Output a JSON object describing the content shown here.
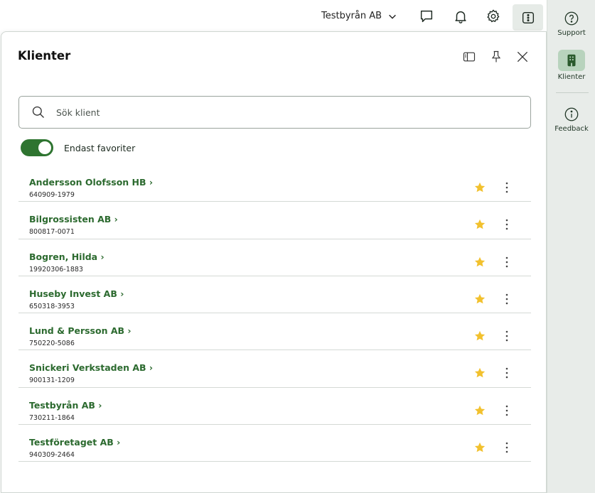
{
  "topbar": {
    "org_name": "Testbyrån AB",
    "icons": [
      "chat-icon",
      "bell-icon",
      "gear-icon",
      "more-vertical-icon"
    ]
  },
  "panel": {
    "title": "Klienter",
    "header_icons": [
      "sidepanel-icon",
      "pin-icon",
      "close-icon"
    ],
    "search": {
      "placeholder": "Sök klient",
      "value": ""
    },
    "favorites_toggle": {
      "label": "Endast favoriter",
      "on": true
    },
    "clients": [
      {
        "name": "Andersson Olofsson HB ›",
        "org_nr": "640909-1979",
        "favorite": true
      },
      {
        "name": "Bilgrossisten AB ›",
        "org_nr": "800817-0071",
        "favorite": true
      },
      {
        "name": "Bogren, Hilda ›",
        "org_nr": "19920306-1883",
        "favorite": true
      },
      {
        "name": "Huseby Invest AB ›",
        "org_nr": "650318-3953",
        "favorite": true
      },
      {
        "name": "Lund & Persson AB ›",
        "org_nr": "750220-5086",
        "favorite": true
      },
      {
        "name": "Snickeri Verkstaden AB ›",
        "org_nr": "900131-1209",
        "favorite": true
      },
      {
        "name": "Testbyrån AB ›",
        "org_nr": "730211-1864",
        "favorite": true
      },
      {
        "name": "Testföretaget AB ›",
        "org_nr": "940309-2464",
        "favorite": true
      }
    ]
  },
  "rail": {
    "items": [
      {
        "label": "Support",
        "icon": "help-circle-icon",
        "active": false
      },
      {
        "label": "Klienter",
        "icon": "building-icon",
        "active": true
      },
      {
        "label": "Feedback",
        "icon": "info-circle-icon",
        "active": false
      }
    ]
  },
  "colors": {
    "brand_green": "#2c6a2f",
    "toggle_green": "#2e7430",
    "star_yellow": "#f2c12e",
    "rail_bg": "#e8ece9",
    "active_bg": "#b8d3bd"
  }
}
